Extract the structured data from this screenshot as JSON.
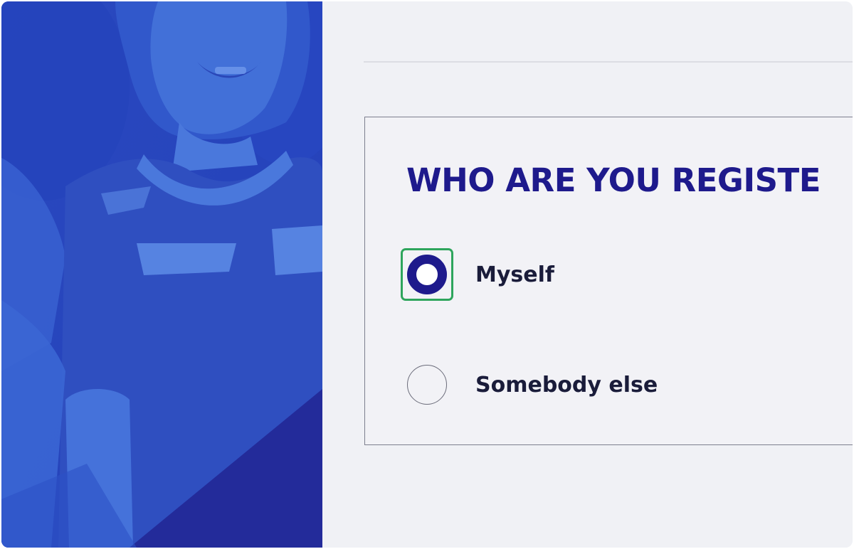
{
  "colors": {
    "brand_navy": "#1e1a8c",
    "focus_green": "#2ea55c",
    "hero_blue": "#2d4fc4",
    "page_bg": "#f0f1f5"
  },
  "hero": {
    "image": "child-photo-blue-overlay"
  },
  "form": {
    "question": "WHO ARE YOU REGISTE",
    "options": [
      {
        "label": "Myself",
        "selected": true,
        "focused": true
      },
      {
        "label": "Somebody else",
        "selected": false,
        "focused": false
      }
    ]
  }
}
